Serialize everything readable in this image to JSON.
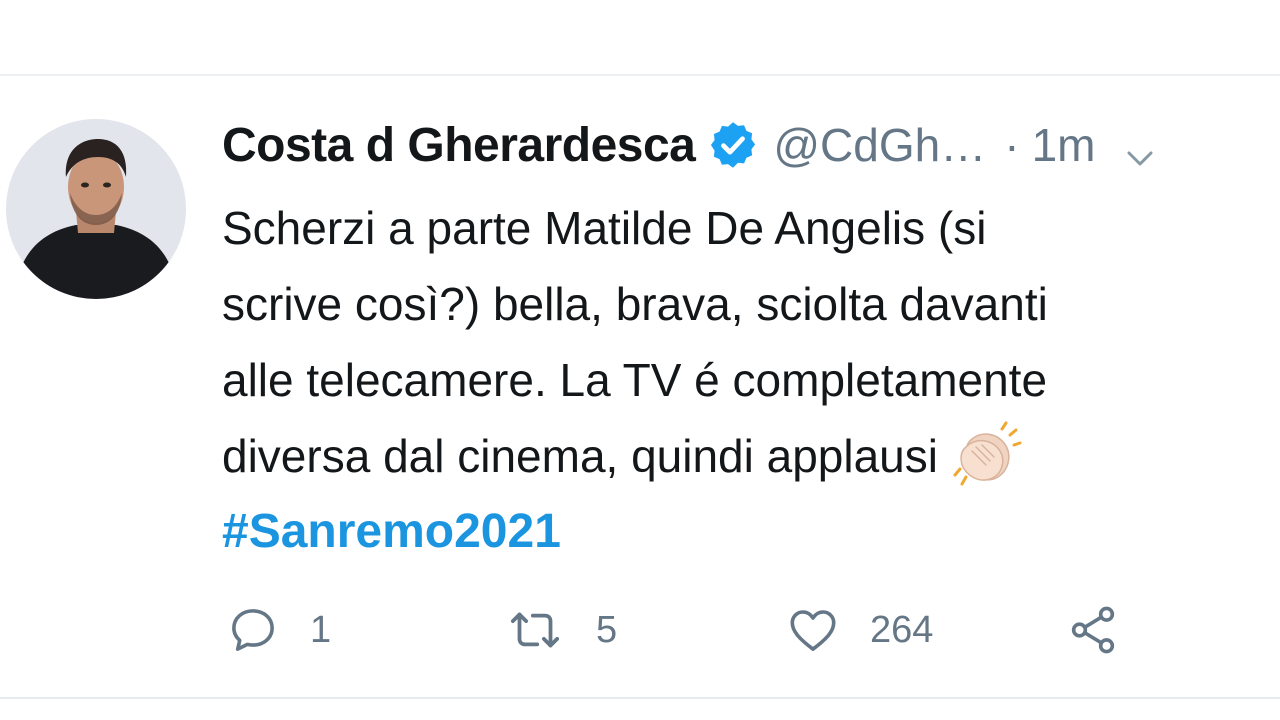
{
  "tweet": {
    "author": {
      "display_name": "Costa d Gherardesca",
      "handle": "@CdGh…",
      "verified": true
    },
    "time_sep": "·",
    "time": "1m",
    "lines": [
      "Scherzi a parte Matilde De Angelis (si",
      "scrive così?) bella, brava, sciolta davanti",
      "alle telecamere. La TV é completamente",
      "diversa dal cinema, quindi applausi"
    ],
    "emoji": "clapping-hands-emoji",
    "hashtag": "#Sanremo2021",
    "actions": {
      "replies": "1",
      "retweets": "5",
      "likes": "264"
    }
  },
  "colors": {
    "text": "#14171a",
    "secondary": "#657786",
    "link": "#1b95e0",
    "verified": "#1da1f2"
  },
  "icons": [
    "verified-badge-icon",
    "chevron-down-icon",
    "reply-icon",
    "retweet-icon",
    "like-icon",
    "share-icon"
  ]
}
